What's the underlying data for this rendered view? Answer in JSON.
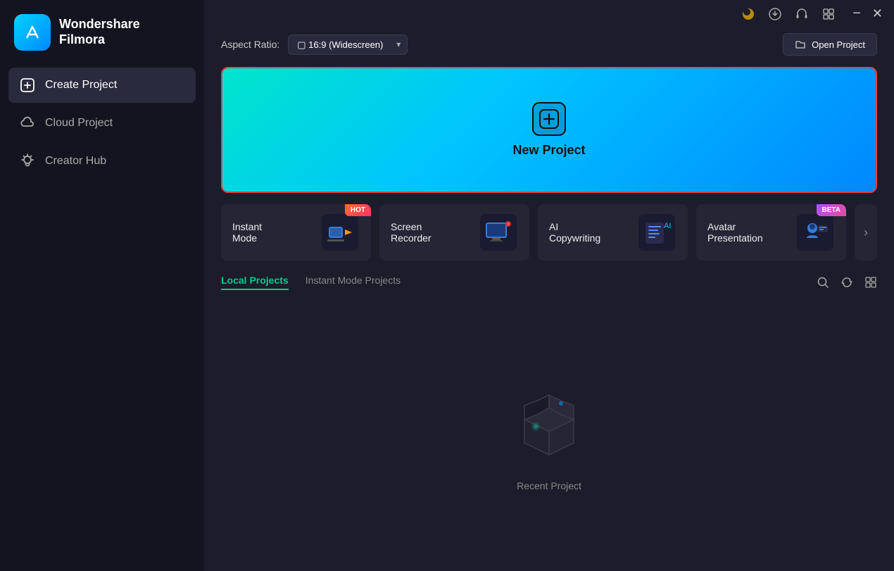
{
  "app": {
    "name": "Wondershare",
    "name2": "Filmora"
  },
  "titlebar": {
    "icons": [
      "moon",
      "download",
      "headset",
      "grid"
    ],
    "window_controls": [
      "minimize",
      "close"
    ]
  },
  "header": {
    "aspect_label": "Aspect Ratio:",
    "aspect_value": "16:9 (Widescreen)",
    "open_project_label": "Open Project"
  },
  "new_project": {
    "label": "New Project"
  },
  "feature_cards": [
    {
      "label": "Instant Mode",
      "badge": "HOT",
      "icon": "🎬"
    },
    {
      "label": "Screen Recorder",
      "badge": "",
      "icon": "🖥"
    },
    {
      "label": "AI Copywriting",
      "badge": "",
      "icon": "✍"
    },
    {
      "label": "Avatar Presentation",
      "badge": "BETA",
      "icon": "👤"
    }
  ],
  "projects": {
    "tabs": [
      {
        "label": "Local Projects",
        "active": true
      },
      {
        "label": "Instant Mode Projects",
        "active": false
      }
    ],
    "tools": [
      "search",
      "refresh",
      "grid-view"
    ]
  },
  "empty_state": {
    "label": "Recent Project"
  },
  "sidebar": {
    "items": [
      {
        "label": "Create Project",
        "icon": "plus-circle",
        "active": true
      },
      {
        "label": "Cloud Project",
        "icon": "cloud",
        "active": false
      },
      {
        "label": "Creator Hub",
        "icon": "lightbulb",
        "active": false
      }
    ]
  }
}
